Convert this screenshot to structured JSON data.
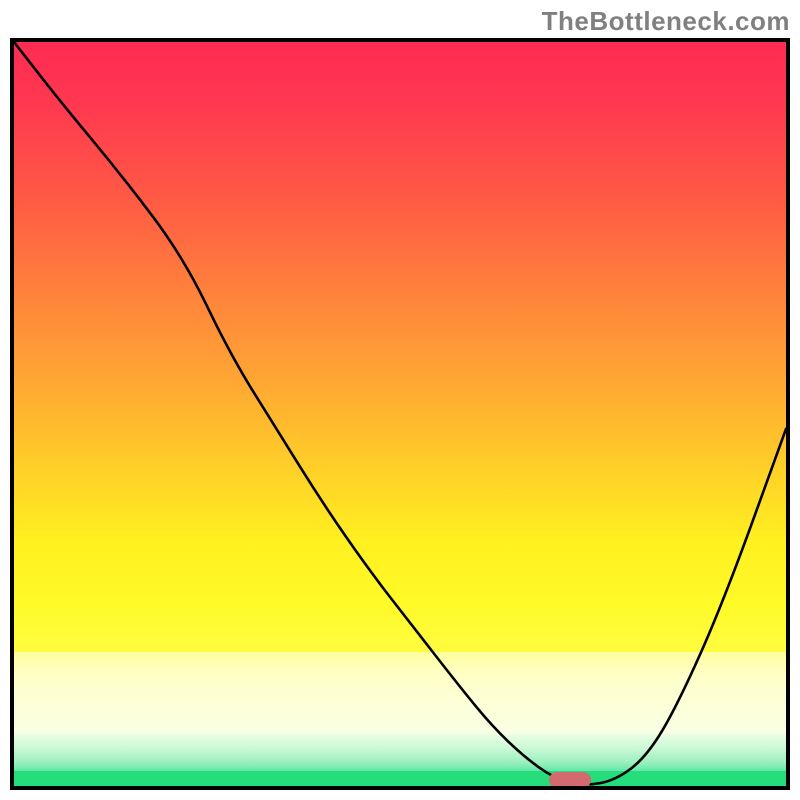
{
  "watermark": "TheBottleneck.com",
  "chart_data": {
    "type": "line",
    "title": "",
    "xlabel": "",
    "ylabel": "",
    "x_range": [
      0,
      100
    ],
    "y_range": [
      0,
      100
    ],
    "grid": false,
    "legend": false,
    "series": [
      {
        "name": "bottleneck_curve",
        "x": [
          0,
          6,
          14,
          22,
          28,
          34,
          40,
          46,
          52,
          58,
          62,
          66,
          70,
          74,
          78,
          82,
          86,
          92,
          100
        ],
        "y": [
          100,
          92,
          82,
          71,
          58,
          48,
          38,
          29,
          21,
          13,
          8,
          4,
          1,
          0,
          0.8,
          4,
          11,
          25,
          48
        ]
      }
    ],
    "marker": {
      "name": "optimal_point",
      "x": 72,
      "y": 0,
      "color": "#d36a6f",
      "width_pct": 5.4,
      "height_pct": 2.2
    },
    "background_gradient": {
      "stops": [
        {
          "pos": 0,
          "color": "#ff2b53"
        },
        {
          "pos": 0.25,
          "color": "#ff5845"
        },
        {
          "pos": 0.5,
          "color": "#ffa534"
        },
        {
          "pos": 0.75,
          "color": "#fff020"
        },
        {
          "pos": 0.9,
          "color": "#ffffc8"
        },
        {
          "pos": 0.96,
          "color": "#9ef0c0"
        },
        {
          "pos": 1.0,
          "color": "#25dd7a"
        }
      ]
    }
  },
  "plot": {
    "inner_width": 772,
    "inner_height": 744
  }
}
